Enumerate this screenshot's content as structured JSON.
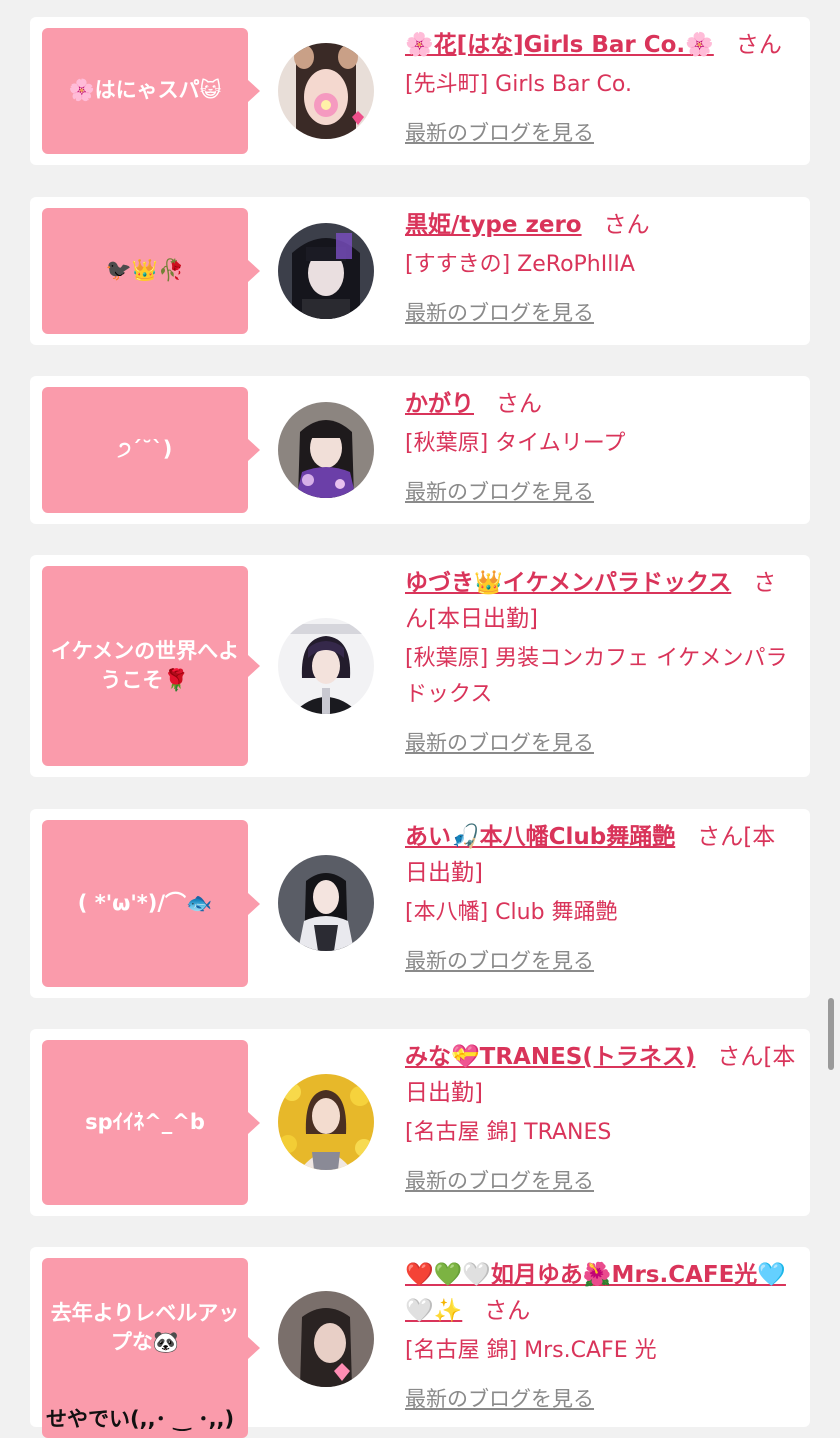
{
  "colors": {
    "accent": "#d9345a",
    "bubble": "#fa9bab",
    "link_gray": "#8a8a8a",
    "background": "#f1f1f1"
  },
  "common": {
    "blog_label": "最新のブログを見る",
    "san": "さん"
  },
  "entries": [
    {
      "message": "🌸はにゃスパ😺",
      "name": "🌸花[はな]Girls Bar Co.🌸",
      "suffix": "さん",
      "shop": "[先斗町] Girls Bar Co.",
      "avatar_icon": "portrait-cat-filter"
    },
    {
      "message": "🐦‍⬛👑🥀",
      "name": "黒姫/type zero",
      "suffix": "さん",
      "shop": "[すすきの] ZeRoPhIlIA",
      "avatar_icon": "portrait-black-hair"
    },
    {
      "message": "੭ˊ˘ˋ)",
      "name": "かがり",
      "suffix": "さん",
      "shop": "[秋葉原] タイムリープ",
      "avatar_icon": "portrait-purple-kimono"
    },
    {
      "message": "イケメンの世界へようこそ🌹",
      "name": "ゆづき👑イケメンパラドックス",
      "suffix": "さん[本日出勤]",
      "shop": "[秋葉原] 男装コンカフェ イケメンパラドックス",
      "avatar_icon": "portrait-ikemen"
    },
    {
      "message": "( *'ω'*)/⌒🐟",
      "name": "あい🎣本八幡Club舞踊艶",
      "suffix": "さん[本日出勤]",
      "shop": "[本八幡] Club 舞踊艶",
      "avatar_icon": "portrait-dress"
    },
    {
      "message": "spｲｲﾈ^_^b",
      "name": "みな💝TRANES(トラネス)",
      "suffix": "さん[本日出勤]",
      "shop": "[名古屋 錦] TRANES",
      "avatar_icon": "portrait-yellow-flowers"
    },
    {
      "message": "去年よりレベルアップな🐼",
      "message_extra": "せやでい(,,･ ‿ ･,,)",
      "name": "❤️💚🤍如月ゆあ🌺Mrs.CAFE光🩵🤍✨",
      "suffix": "さん",
      "shop": "[名古屋 錦] Mrs.CAFE 光",
      "avatar_icon": "portrait-blurred-heart"
    }
  ]
}
